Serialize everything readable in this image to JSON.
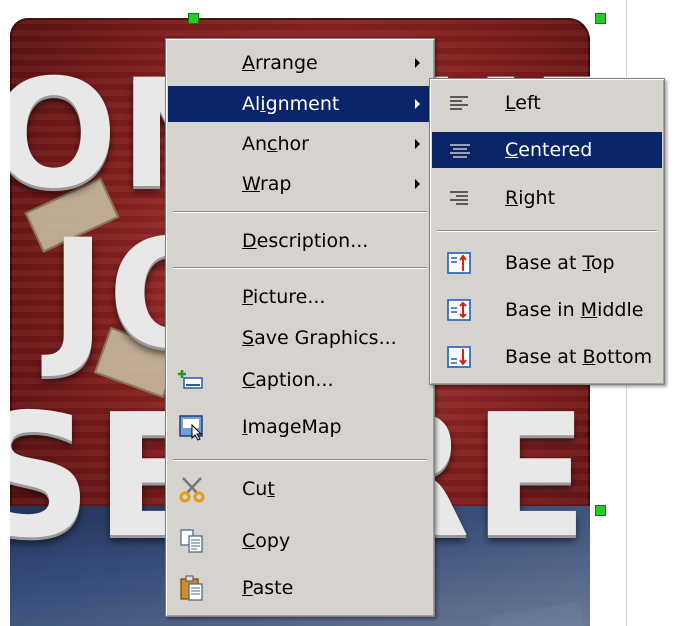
{
  "background": {
    "words": [
      "ONLINE",
      "JOB",
      "SECRET"
    ]
  },
  "context_menu": {
    "items": [
      {
        "label": "Arrange",
        "mnemonic_index": 0,
        "has_submenu": true
      },
      {
        "label": "Alignment",
        "mnemonic_index": 2,
        "has_submenu": true,
        "selected": true
      },
      {
        "label": "Anchor",
        "mnemonic_index": 2,
        "has_submenu": true
      },
      {
        "label": "Wrap",
        "mnemonic_index": 0,
        "has_submenu": true
      },
      {
        "label": "Description...",
        "mnemonic_index": 0
      },
      {
        "label": "Picture...",
        "mnemonic_index": 0
      },
      {
        "label": "Save Graphics...",
        "mnemonic_index": 0
      },
      {
        "label": "Caption...",
        "mnemonic_index": 0,
        "icon": "caption-icon"
      },
      {
        "label": "ImageMap",
        "mnemonic_index": 0,
        "icon": "imagemap-icon"
      },
      {
        "label": "Cut",
        "mnemonic_index": 2,
        "icon": "scissors-icon"
      },
      {
        "label": "Copy",
        "mnemonic_index": 0,
        "icon": "copy-icon"
      },
      {
        "label": "Paste",
        "mnemonic_index": 0,
        "icon": "paste-icon"
      }
    ]
  },
  "alignment_submenu": {
    "items": [
      {
        "label": "Left",
        "mnemonic_index": 0,
        "icon": "align-left-icon"
      },
      {
        "label": "Centered",
        "mnemonic_index": 0,
        "icon": "align-center-icon",
        "selected": true
      },
      {
        "label": "Right",
        "mnemonic_index": 0,
        "icon": "align-right-icon"
      },
      {
        "label": "Base at Top",
        "mnemonic_index": 8,
        "icon": "base-top-icon"
      },
      {
        "label": "Base in Middle",
        "mnemonic_index": 8,
        "icon": "base-middle-icon"
      },
      {
        "label": "Base at Bottom",
        "mnemonic_index": 8,
        "icon": "base-bottom-icon"
      }
    ]
  },
  "colors": {
    "menu_bg": "#d6d3ce",
    "highlight": "#0a246a",
    "handle": "#22cc22"
  }
}
